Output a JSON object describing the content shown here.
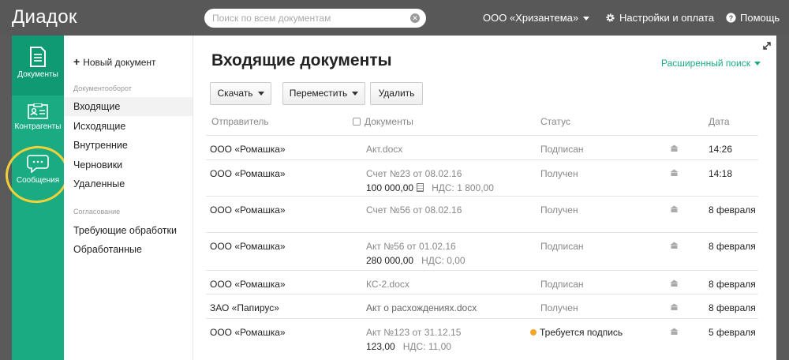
{
  "app": {
    "logo": "Диадок"
  },
  "header": {
    "search_placeholder": "Поиск по всем документам",
    "organization": "ООО «Хризантема»",
    "settings_label": "Настройки и оплата",
    "help_label": "Помощь"
  },
  "rail": {
    "items": [
      {
        "label": "Документы",
        "icon": "document-icon"
      },
      {
        "label": "Контрагенты",
        "icon": "contacts-icon"
      },
      {
        "label": "Сообщения",
        "icon": "chat-bubble-icon"
      }
    ]
  },
  "subnav": {
    "new_doc_label": "Новый документ",
    "section_workflow": "Документооборот",
    "workflow_items": [
      "Входящие",
      "Исходящие",
      "Внутренние",
      "Черновики",
      "Удаленные"
    ],
    "section_approval": "Согласование",
    "approval_items": [
      "Требующие обработки",
      "Обработанные"
    ]
  },
  "main": {
    "title": "Входящие документы",
    "advanced_search": "Расширенный поиск",
    "toolbar": {
      "download": "Скачать",
      "move": "Переместить",
      "delete": "Удалить"
    },
    "columns": {
      "sender": "Отправитель",
      "documents": "Документы",
      "status": "Статус",
      "date": "Дата"
    },
    "rows": [
      {
        "sender": "ООО «Ромашка»",
        "doc": "Акт.docx",
        "amount": "",
        "vat": "",
        "status": "Подписан",
        "date": "14:26"
      },
      {
        "sender": "ООО «Ромашка»",
        "doc": "Счет №23 от 08.02.16",
        "amount": "100 000,00",
        "vat": "НДС: 1 800,00",
        "status": "Получен",
        "date": "14:18"
      },
      {
        "sender": "ООО «Ромашка»",
        "doc": "Счет №56 от 08.02.16",
        "amount": "",
        "vat": "",
        "status": "Получен",
        "date": "8 февраля"
      },
      {
        "sender": "ООО «Ромашка»",
        "doc": "Акт №56 от 01.02.16",
        "amount": "280 000,00",
        "vat": "НДС: 0,00",
        "status": "Подписан",
        "date": "8 февраля"
      },
      {
        "sender": "ООО «Ромашка»",
        "doc": "КС-2.docx",
        "amount": "",
        "vat": "",
        "status": "Подписан",
        "date": "8 февраля"
      },
      {
        "sender": "ЗАО «Папирус»",
        "doc": "Акт о расхождениях.docx",
        "amount": "",
        "vat": "",
        "status": "Получен",
        "date": "8 февраля"
      },
      {
        "sender": "ООО «Ромашка»",
        "doc": "Акт №123 от 31.12.15",
        "amount": "123,00",
        "vat": "НДС: 11,00",
        "status": "Требуется подпись",
        "date": "5 февраля"
      }
    ]
  },
  "colors": {
    "accent": "#1aab83",
    "topbar": "#585858",
    "highlight": "#f1d13a",
    "warning_dot": "#f4a62a"
  }
}
